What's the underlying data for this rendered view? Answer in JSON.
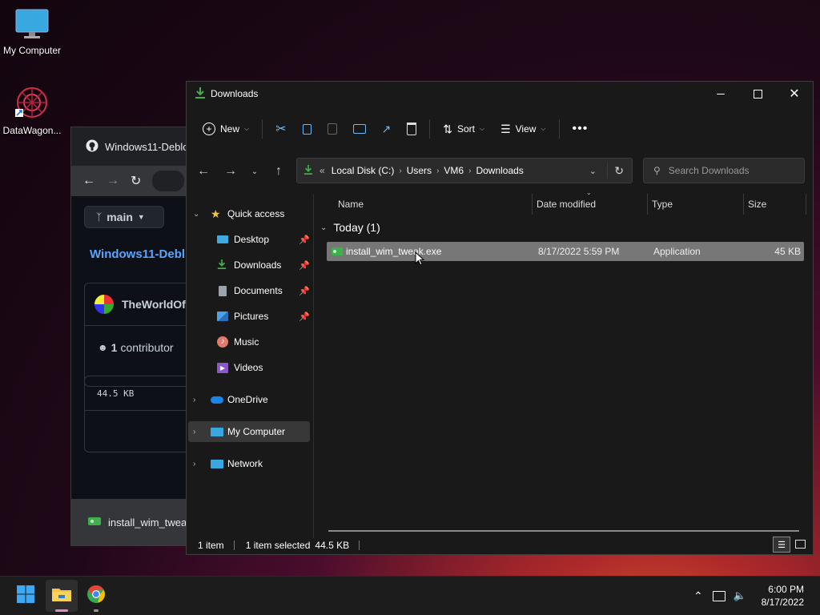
{
  "desktop": {
    "icons": [
      {
        "label": "My Computer",
        "icon": "monitor-icon"
      },
      {
        "label": "DataWagon...",
        "icon": "datawagon-icon"
      }
    ]
  },
  "browser": {
    "tab_title": "Windows11-Deblo",
    "branch": "main",
    "repo": "Windows11-Debl",
    "author": "TheWorldOf",
    "contributors_count": "1",
    "contributors_label": "contributor",
    "file_size": "44.5 KB",
    "download_name": "install_wim_twea"
  },
  "explorer": {
    "title": "Downloads",
    "toolbar": {
      "new": "New",
      "sort": "Sort",
      "view": "View"
    },
    "address": {
      "prefix": "«",
      "crumbs": [
        "Local Disk (C:)",
        "Users",
        "VM6",
        "Downloads"
      ]
    },
    "search_placeholder": "Search Downloads",
    "nav": {
      "quick_access": "Quick access",
      "items": [
        {
          "label": "Desktop",
          "pinned": true
        },
        {
          "label": "Downloads",
          "pinned": true
        },
        {
          "label": "Documents",
          "pinned": true
        },
        {
          "label": "Pictures",
          "pinned": true
        },
        {
          "label": "Music",
          "pinned": false
        },
        {
          "label": "Videos",
          "pinned": false
        }
      ],
      "onedrive": "OneDrive",
      "my_computer": "My Computer",
      "network": "Network"
    },
    "columns": [
      "Name",
      "Date modified",
      "Type",
      "Size"
    ],
    "group_label": "Today (1)",
    "files": [
      {
        "name": "install_wim_tweak.exe",
        "date": "8/17/2022 5:59 PM",
        "type": "Application",
        "size": "45 KB"
      }
    ],
    "status": {
      "count": "1 item",
      "selected": "1 item selected",
      "size": "44.5 KB"
    }
  },
  "taskbar": {
    "time": "6:00 PM",
    "date": "8/17/2022"
  },
  "colors": {
    "accent": "#0a84ff",
    "folder_yellow": "#f4c542",
    "download_green": "#3fb04b"
  }
}
